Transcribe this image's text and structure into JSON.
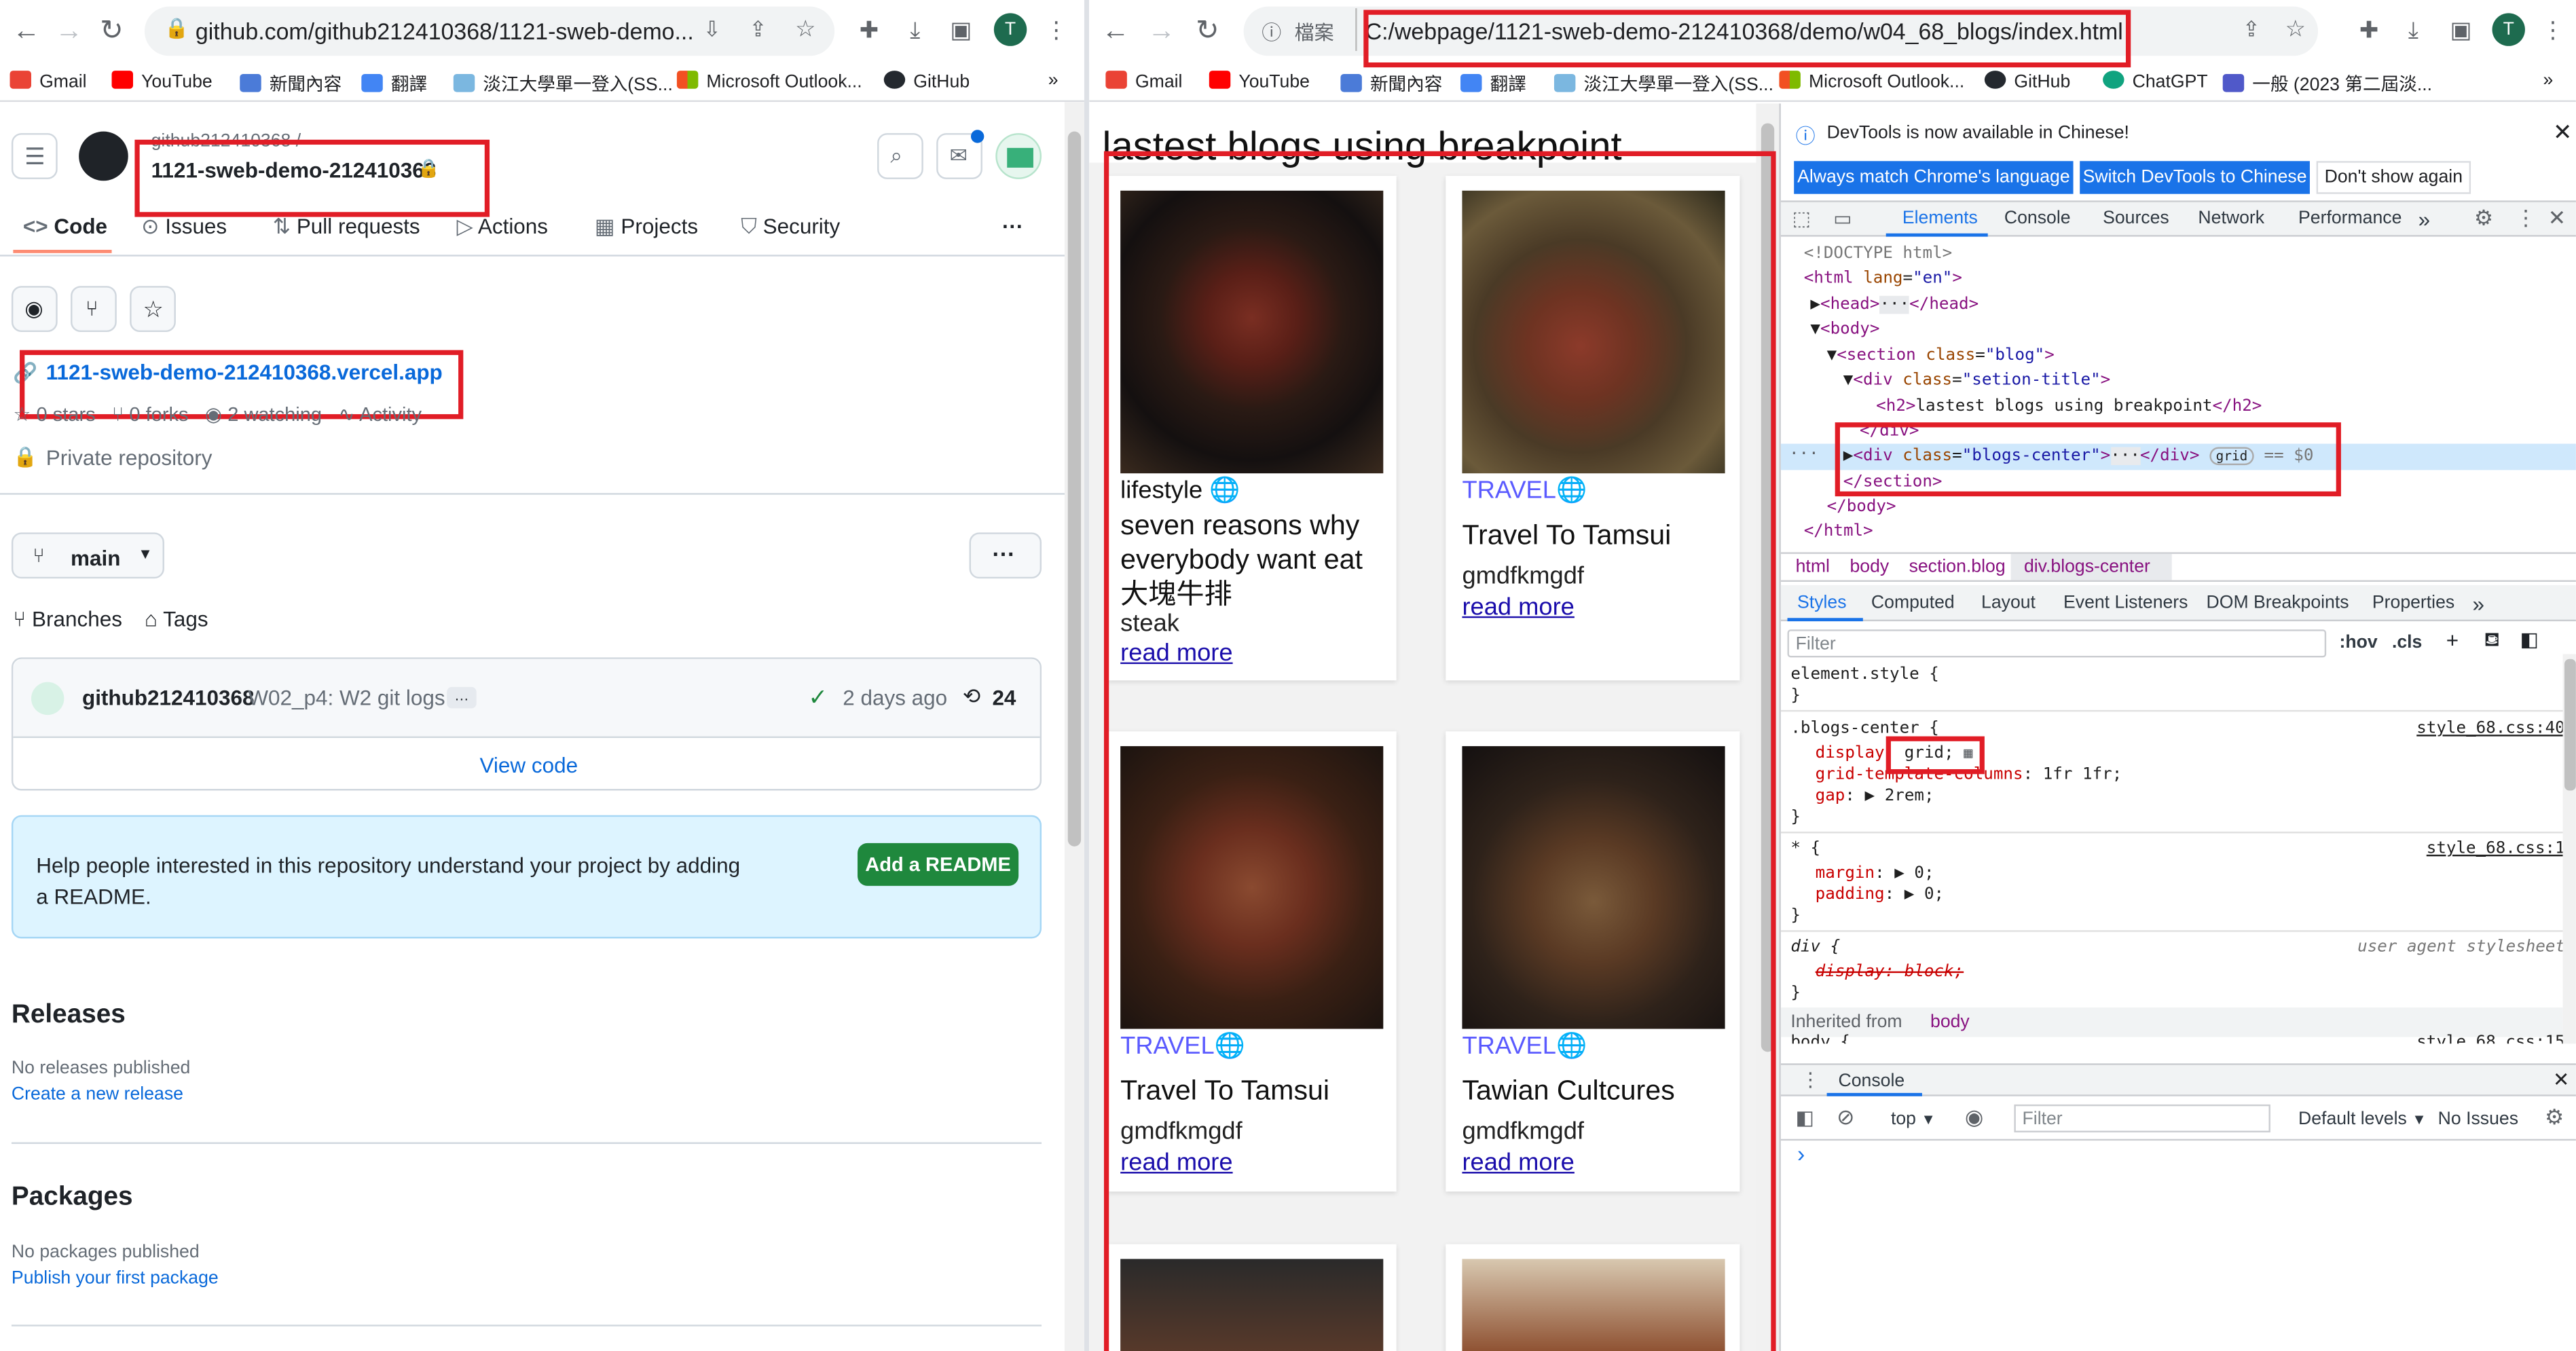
{
  "left_browser": {
    "url": "github.com/github212410368/1121-sweb-demo...",
    "bookmarks": [
      "Gmail",
      "YouTube",
      "新聞內容",
      "翻譯",
      "淡江大學單一登入(SS...",
      "Microsoft Outlook...",
      "GitHub"
    ],
    "bookmarks_more": "»"
  },
  "github": {
    "owner": "github212410368 /",
    "repo": "1121-sweb-demo-212410368",
    "tabs": [
      "Code",
      "Issues",
      "Pull requests",
      "Actions",
      "Projects",
      "Security"
    ],
    "more": "···",
    "website": "1121-sweb-demo-212410368.vercel.app",
    "stats": {
      "stars": "0 stars",
      "forks": "0 forks",
      "watching": "2 watching",
      "activity": "Activity"
    },
    "private": "Private repository",
    "branch": "main",
    "branches": "Branches",
    "tags": "Tags",
    "commit": {
      "author": "github212410368",
      "message": "W02_p4: W2 git logs",
      "dots": "…",
      "time": "2 days ago",
      "count": "24"
    },
    "view_code": "View code",
    "readme_text": "Help people interested in this repository understand your project by adding a README.",
    "readme_button": "Add a README",
    "releases": {
      "heading": "Releases",
      "empty": "No releases published",
      "link": "Create a new release"
    },
    "packages": {
      "heading": "Packages",
      "empty": "No packages published",
      "link": "Publish your first package"
    }
  },
  "right_browser": {
    "url_prefix": "檔案",
    "url": "C:/webpage/1121-sweb-demo-212410368/demo/w04_68_blogs/index.html",
    "bookmarks": [
      "Gmail",
      "YouTube",
      "新聞內容",
      "翻譯",
      "淡江大學單一登入(SS...",
      "Microsoft Outlook...",
      "GitHub",
      "ChatGPT",
      "一般 (2023 第二屆淡..."
    ],
    "bookmarks_more": "»"
  },
  "blog": {
    "heading": "lastest blogs using breakpoint",
    "cards": [
      {
        "tag": "lifestyle",
        "title": "seven reasons why everybody want eat 大塊牛排",
        "sub": "steak",
        "more": "read more"
      },
      {
        "tag": "TRAVEL",
        "title": "Travel To Tamsui",
        "sub": "gmdfkmgdf",
        "more": "read more"
      },
      {
        "tag": "TRAVEL",
        "title": "Travel To Tamsui",
        "sub": "gmdfkmgdf",
        "more": "read more"
      },
      {
        "tag": "TRAVEL",
        "title": "Tawian Cultcures",
        "sub": "gmdfkmgdf",
        "more": "read more"
      }
    ]
  },
  "devtools": {
    "notice": "DevTools is now available in Chinese!",
    "btn_match": "Always match Chrome's language",
    "btn_switch": "Switch DevTools to Chinese",
    "btn_dont": "Don't show again",
    "tabs": [
      "Elements",
      "Console",
      "Sources",
      "Network",
      "Performance"
    ],
    "dom": {
      "doctype": "<!DOCTYPE html>",
      "html_open": "html",
      "html_lang_attr": "lang",
      "html_lang_val": "\"en\"",
      "head": "head",
      "body": "body",
      "section": "section",
      "section_attr": "class",
      "section_val": "\"blog\"",
      "div_title_val": "\"setion-title\"",
      "h2_text": "lastest blogs using breakpoint",
      "div_close": "</div>",
      "blogs_center_val": "\"blogs-center\"",
      "grid_badge": "grid",
      "eq": "== $0",
      "section_close": "</section>",
      "body_close": "</body>",
      "html_close": "</html>"
    },
    "breadcrumbs": [
      "html",
      "body",
      "section.blog",
      "div.blogs-center"
    ],
    "sub_tabs": [
      "Styles",
      "Computed",
      "Layout",
      "Event Listeners",
      "DOM Breakpoints",
      "Properties"
    ],
    "filter_placeholder": "Filter",
    "hov": ":hov",
    "cls": ".cls",
    "rules": {
      "element_style": "element.style {",
      "blogs_selector": ".blogs-center {",
      "blogs_source": "style_68.css:40",
      "p_display": "display",
      "v_display": "grid;",
      "p_cols": "grid-template-columns",
      "v_cols": "1fr 1fr;",
      "p_gap": "gap",
      "v_gap": "2rem;",
      "star_selector": "* {",
      "star_source": "style_68.css:1",
      "p_margin": "margin",
      "v_margin": "0;",
      "p_padding": "padding",
      "v_padding": "0;",
      "div_selector": "div {",
      "ua": "user agent stylesheet",
      "div_display": "display: block;",
      "inherited": "Inherited from",
      "inherited_el": "body",
      "cut": "body {",
      "cut_source": "style_68.css:15"
    },
    "console": {
      "title": "Console",
      "context": "top",
      "filter_placeholder": "Filter",
      "levels": "Default levels",
      "issues": "No Issues",
      "prompt": "›"
    }
  },
  "colors": {
    "red_box": "#e11d26",
    "github_green": "#1f883d",
    "chrome_blue": "#1a73e8",
    "travel": "#5a5aff"
  }
}
